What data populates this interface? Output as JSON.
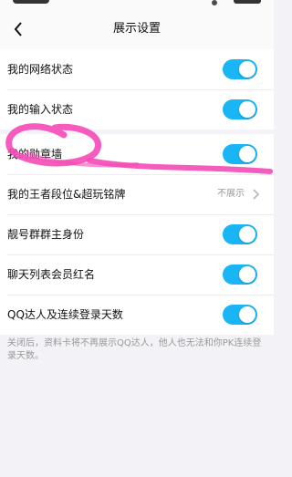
{
  "header": {
    "title": "展示设置"
  },
  "section1": {
    "items": [
      {
        "label": "我的网络状态",
        "on": true
      },
      {
        "label": "我的输入状态",
        "on": true
      }
    ]
  },
  "section2": {
    "items": [
      {
        "label": "我的勋章墙",
        "on": true
      },
      {
        "label": "我的王者段位&超玩铭牌",
        "value": "不展示"
      },
      {
        "label": "靓号群群主身份",
        "on": true
      },
      {
        "label": "聊天列表会员红名",
        "on": true
      },
      {
        "label": "QQ达人及连续登录天数",
        "on": true
      }
    ]
  },
  "footnote": "关闭后，资料卡将不再展示QQ达人，他人也无法和你PK连续登录天数。",
  "colors": {
    "accent": "#19b5f5",
    "highlight": "#f54ab6"
  }
}
